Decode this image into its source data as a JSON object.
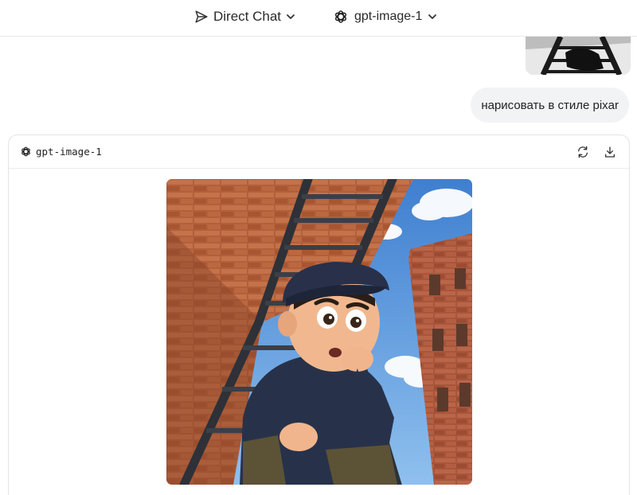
{
  "header": {
    "mode_label": "Direct Chat",
    "model_label": "gpt-image-1"
  },
  "icons": {
    "mode": "send-icon",
    "model": "openai-logo-icon",
    "dropdown": "chevron-down-icon",
    "regenerate": "refresh-icon",
    "download": "download-icon"
  },
  "conversation": {
    "user_message": "нарисовать в стиле pixar",
    "response": {
      "model_name": "gpt-image-1",
      "image_alt": "Pixar-style cartoon boy in a dark flat cap climbing a metal fire-escape ladder between brick buildings under a blue sky"
    }
  },
  "colors": {
    "accent_text": "#2a2a2a",
    "bubble_bg": "#f2f3f5",
    "border": "#e3e3e3",
    "sky": "#5a93d6",
    "brick": "#b5623d"
  }
}
